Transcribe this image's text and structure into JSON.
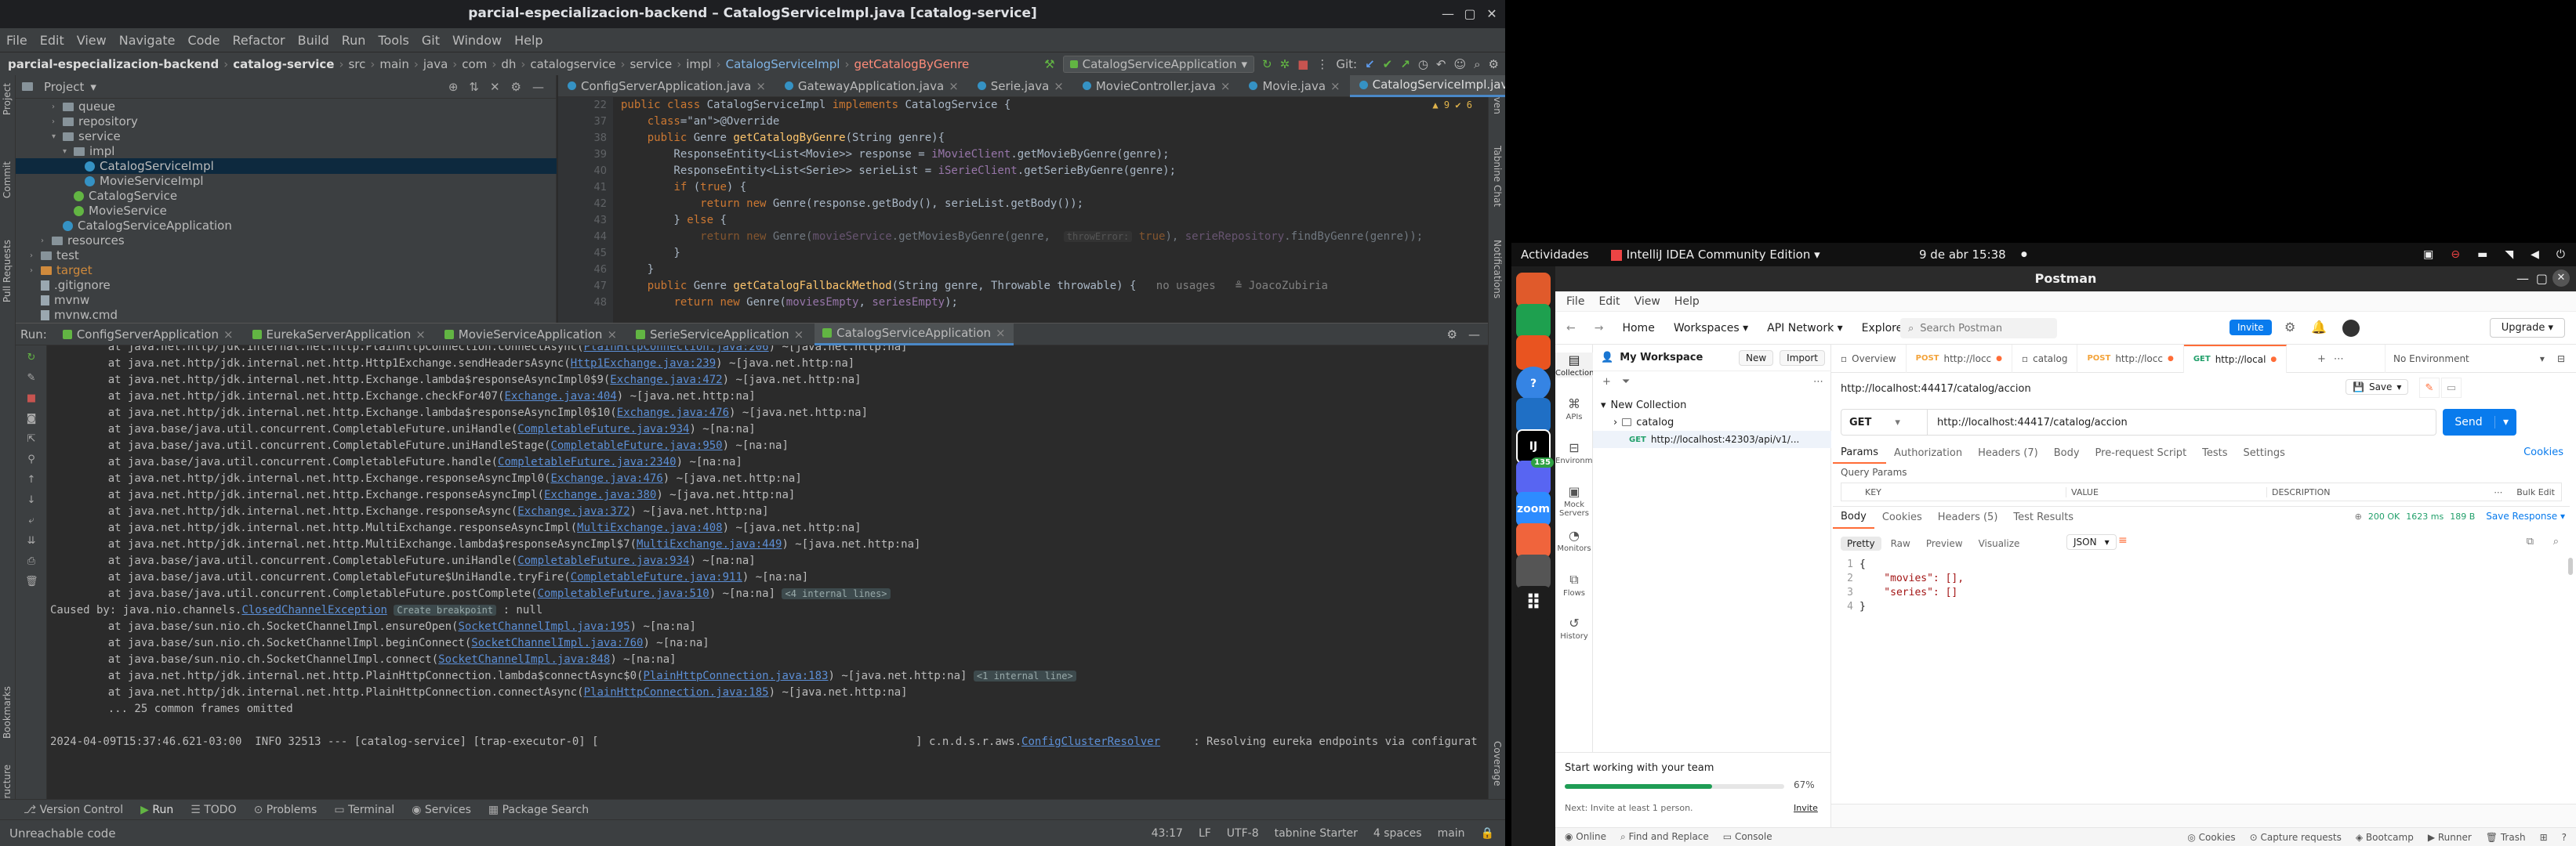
{
  "ij": {
    "title": "parcial-especializacion-backend – CatalogServiceImpl.java [catalog-service]",
    "menu": [
      "File",
      "Edit",
      "View",
      "Navigate",
      "Code",
      "Refactor",
      "Build",
      "Run",
      "Tools",
      "Git",
      "Window",
      "Help"
    ],
    "crumbs": [
      "parcial-especializacion-backend",
      "catalog-service",
      "src",
      "main",
      "java",
      "com",
      "dh",
      "catalogservice",
      "service",
      "impl",
      "CatalogServiceImpl",
      "getCatalogByGenre"
    ],
    "run_config": "CatalogServiceApplication",
    "git_label": "Git:",
    "project_label": "Project",
    "tree": [
      {
        "label": "queue",
        "kind": "folder",
        "indent": 3,
        "open": false
      },
      {
        "label": "repository",
        "kind": "folder",
        "indent": 3,
        "open": false
      },
      {
        "label": "service",
        "kind": "folder",
        "indent": 3,
        "open": true
      },
      {
        "label": "impl",
        "kind": "folder",
        "indent": 4,
        "open": true
      },
      {
        "label": "CatalogServiceImpl",
        "kind": "class",
        "indent": 5,
        "selected": true
      },
      {
        "label": "MovieServiceImpl",
        "kind": "class",
        "indent": 5
      },
      {
        "label": "CatalogService",
        "kind": "iface",
        "indent": 4
      },
      {
        "label": "MovieService",
        "kind": "iface",
        "indent": 4
      },
      {
        "label": "CatalogServiceApplication",
        "kind": "class",
        "indent": 3
      },
      {
        "label": "resources",
        "kind": "folder",
        "indent": 2,
        "open": false
      },
      {
        "label": "test",
        "kind": "folder",
        "indent": 1,
        "open": false
      },
      {
        "label": "target",
        "kind": "folder",
        "indent": 1,
        "open": false
      },
      {
        "label": ".gitignore",
        "kind": "file",
        "indent": 1
      },
      {
        "label": "mvnw",
        "kind": "file",
        "indent": 1
      },
      {
        "label": "mvnw.cmd",
        "kind": "file",
        "indent": 1
      }
    ],
    "tabs": [
      {
        "label": "ConfigServerApplication.java"
      },
      {
        "label": "GatewayApplication.java"
      },
      {
        "label": "Serie.java"
      },
      {
        "label": "MovieController.java"
      },
      {
        "label": "Movie.java"
      },
      {
        "label": "CatalogServiceImpl.java",
        "active": true
      }
    ],
    "inspection": "▲ 9  ✔ 6",
    "line_numbers": [
      "22",
      "37",
      "38",
      "39",
      "40",
      "41",
      "42",
      "43",
      "44",
      "45",
      "46",
      "47",
      "48",
      "49"
    ],
    "code": [
      "public class CatalogServiceImpl implements CatalogService {",
      "    @Override",
      "    public Genre getCatalogByGenre(String genre){",
      "        ResponseEntity<List<Movie>> response = iMovieClient.getMovieByGenre(genre);",
      "        ResponseEntity<List<Serie>> serieList = iSerieClient.getSerieByGenre(genre);",
      "        if (true) {",
      "            return new Genre(response.getBody(), serieList.getBody());",
      "        } else {",
      "            return new Genre(movieService.getMoviesByGenre(genre,  throwError: true), serieRepository.findByGenre(genre));",
      "        }",
      "    }",
      "    public Genre getCatalogFallbackMethod(String genre, Throwable throwable) {   no usages   ≗ JoacoZubiria",
      "        return new Genre(moviesEmpty, seriesEmpty);"
    ],
    "run_label": "Run:",
    "run_tabs": [
      "ConfigServerApplication",
      "EurekaServerApplication",
      "MovieServiceApplication",
      "SerieServiceApplication",
      "CatalogServiceApplication"
    ],
    "console": [
      [
        "at java.net.http/jdk.internal.net.http.PlainHttpConnection.connectAsync(",
        "PlainHttpConnection.java:206",
        ") ~[java.net.http:na]"
      ],
      [
        "at java.net.http/jdk.internal.net.http.Http1Exchange.sendHeadersAsync(",
        "Http1Exchange.java:239",
        ") ~[java.net.http:na]"
      ],
      [
        "at java.net.http/jdk.internal.net.http.Exchange.lambda$responseAsyncImpl0$9(",
        "Exchange.java:472",
        ") ~[java.net.http:na]"
      ],
      [
        "at java.net.http/jdk.internal.net.http.Exchange.checkFor407(",
        "Exchange.java:404",
        ") ~[java.net.http:na]"
      ],
      [
        "at java.net.http/jdk.internal.net.http.Exchange.lambda$responseAsyncImpl0$10(",
        "Exchange.java:476",
        ") ~[java.net.http:na]"
      ],
      [
        "at java.base/java.util.concurrent.CompletableFuture.uniHandle(",
        "CompletableFuture.java:934",
        ") ~[na:na]"
      ],
      [
        "at java.base/java.util.concurrent.CompletableFuture.uniHandleStage(",
        "CompletableFuture.java:950",
        ") ~[na:na]"
      ],
      [
        "at java.base/java.util.concurrent.CompletableFuture.handle(",
        "CompletableFuture.java:2340",
        ") ~[na:na]"
      ],
      [
        "at java.net.http/jdk.internal.net.http.Exchange.responseAsyncImpl0(",
        "Exchange.java:476",
        ") ~[java.net.http:na]"
      ],
      [
        "at java.net.http/jdk.internal.net.http.Exchange.responseAsyncImpl(",
        "Exchange.java:380",
        ") ~[java.net.http:na]"
      ],
      [
        "at java.net.http/jdk.internal.net.http.Exchange.responseAsync(",
        "Exchange.java:372",
        ") ~[java.net.http:na]"
      ],
      [
        "at java.net.http/jdk.internal.net.http.MultiExchange.responseAsyncImpl(",
        "MultiExchange.java:408",
        ") ~[java.net.http:na]"
      ],
      [
        "at java.net.http/jdk.internal.net.http.MultiExchange.lambda$responseAsyncImpl$7(",
        "MultiExchange.java:449",
        ") ~[java.net.http:na]"
      ],
      [
        "at java.base/java.util.concurrent.CompletableFuture.uniHandle(",
        "CompletableFuture.java:934",
        ") ~[na:na]"
      ],
      [
        "at java.base/java.util.concurrent.CompletableFuture$UniHandle.tryFire(",
        "CompletableFuture.java:911",
        ") ~[na:na]"
      ],
      [
        "at java.base/java.util.concurrent.CompletableFuture.postComplete(",
        "CompletableFuture.java:510",
        ") ~[na:na]"
      ]
    ],
    "console_internal1": "<4 internal lines>",
    "caused_by_pre": "Caused by: java.nio.channels.",
    "caused_by_link": "ClosedChannelException",
    "caused_by_bp": "Create breakpoint",
    "caused_by_post": " : null",
    "console2": [
      [
        "at java.base/sun.nio.ch.SocketChannelImpl.ensureOpen(",
        "SocketChannelImpl.java:195",
        ") ~[na:na]"
      ],
      [
        "at java.base/sun.nio.ch.SocketChannelImpl.beginConnect(",
        "SocketChannelImpl.java:760",
        ") ~[na:na]"
      ],
      [
        "at java.base/sun.nio.ch.SocketChannelImpl.connect(",
        "SocketChannelImpl.java:848",
        ") ~[na:na]"
      ],
      [
        "at java.net.http/jdk.internal.net.http.PlainHttpConnection.lambda$connectAsync$0(",
        "PlainHttpConnection.java:183",
        ") ~[java.net.http:na]"
      ],
      [
        "at java.net.http/jdk.internal.net.http.PlainHttpConnection.connectAsync(",
        "PlainHttpConnection.java:185",
        ") ~[java.net.http:na]"
      ]
    ],
    "console_internal2": "<1 internal line>",
    "omitted": "... 25 common frames omitted",
    "last_log_a": "2024-04-09T15:37:46.621-03:00  INFO 32513 --- [catalog-service] [trap-executor-0] [",
    "last_log_b": "] c.n.d.s.r.aws.",
    "last_log_link": "ConfigClusterResolver",
    "last_log_c": "     : Resolving eureka endpoints via configuration",
    "bottom_tabs": [
      "Version Control",
      "Run",
      "TODO",
      "Problems",
      "Terminal",
      "Services",
      "Package Search"
    ],
    "status_left": "Unreachable code",
    "status_right": [
      "43:17",
      "LF",
      "UTF-8",
      "tabnine Starter",
      "4 spaces",
      "main"
    ],
    "left_stripe": [
      "Project",
      "Commit",
      "Pull Requests",
      "Bookmarks",
      "Structure"
    ],
    "right_stripe": [
      "Maven",
      "Tabnine Chat",
      "Notifications",
      "Coverage"
    ]
  },
  "top": {
    "activities": "Actividades",
    "app": "IntelliJ IDEA Community Edition",
    "clock": "9 de abr  15:38"
  },
  "dock": [
    {
      "name": "files",
      "label": ""
    },
    {
      "name": "libreoffice-calc",
      "label": ""
    },
    {
      "name": "software-center",
      "label": ""
    },
    {
      "name": "help",
      "label": "?"
    },
    {
      "name": "vscode",
      "label": ""
    },
    {
      "name": "intellij",
      "label": "IJ"
    },
    {
      "name": "discord",
      "label": "",
      "badge": "135"
    },
    {
      "name": "zoom",
      "label": "zoom"
    },
    {
      "name": "postman",
      "label": ""
    },
    {
      "name": "trash",
      "label": ""
    },
    {
      "name": "app-grid",
      "label": ""
    }
  ],
  "pm": {
    "title": "Postman",
    "menu": [
      "File",
      "Edit",
      "View",
      "Help"
    ],
    "home": "Home",
    "workspaces": "Workspaces",
    "api_network": "API Network",
    "explore": "Explore",
    "search": "Search Postman",
    "invite": "Invite",
    "upgrade": "Upgrade",
    "workspace_name": "My Workspace",
    "new_btn": "New",
    "import_btn": "Import",
    "sidebar": [
      "Collections",
      "APIs",
      "Environments",
      "Mock Servers",
      "Monitors",
      "Flows",
      "History"
    ],
    "collections": {
      "root": "New Collection",
      "folder": "catalog",
      "request_method": "GET",
      "request_url": "http://localhost:42303/api/v1/..."
    },
    "tabs": [
      {
        "method": "",
        "label": "Overview"
      },
      {
        "method": "POST",
        "label": "http://locc"
      },
      {
        "method": "",
        "label": "catalog"
      },
      {
        "method": "POST",
        "label": "http://locc"
      },
      {
        "method": "GET",
        "label": "http://local",
        "active": true
      }
    ],
    "environment": "No Environment",
    "req_title": "http://localhost:44417/catalog/accion",
    "save": "Save",
    "method": "GET",
    "url": "http://localhost:44417/catalog/accion",
    "send": "Send",
    "req_tabs": [
      "Params",
      "Authorization",
      "Headers (7)",
      "Body",
      "Pre-request Script",
      "Tests",
      "Settings"
    ],
    "cookies": "Cookies",
    "query_params": "Query Params",
    "params_cols": [
      "KEY",
      "VALUE",
      "DESCRIPTION"
    ],
    "bulk_edit": "Bulk Edit",
    "res_tabs": [
      "Body",
      "Cookies",
      "Headers (5)",
      "Test Results"
    ],
    "status": "200 OK",
    "time": "1623 ms",
    "size": "189 B",
    "save_response": "Save Response",
    "view_tabs": [
      "Pretty",
      "Raw",
      "Preview",
      "Visualize"
    ],
    "format": "JSON",
    "json_lines": [
      "{",
      "    \"movies\": [],",
      "    \"series\": []",
      "}"
    ],
    "onboard_title": "Start working with your team",
    "onboard_pct": "67%",
    "onboard_progress": 0.67,
    "onboard_next": "Next: Invite at least 1 person.",
    "onboard_invite": "Invite",
    "footer_left": [
      "Online",
      "Find and Replace",
      "Console"
    ],
    "footer_right": [
      "Cookies",
      "Capture requests",
      "Bootcamp",
      "Runner",
      "Trash"
    ]
  },
  "colors": {
    "postman_orange": "#ff6c37",
    "send_blue": "#097bed",
    "ij_bg": "#2b2b2b",
    "status_green": "#22a06b"
  }
}
